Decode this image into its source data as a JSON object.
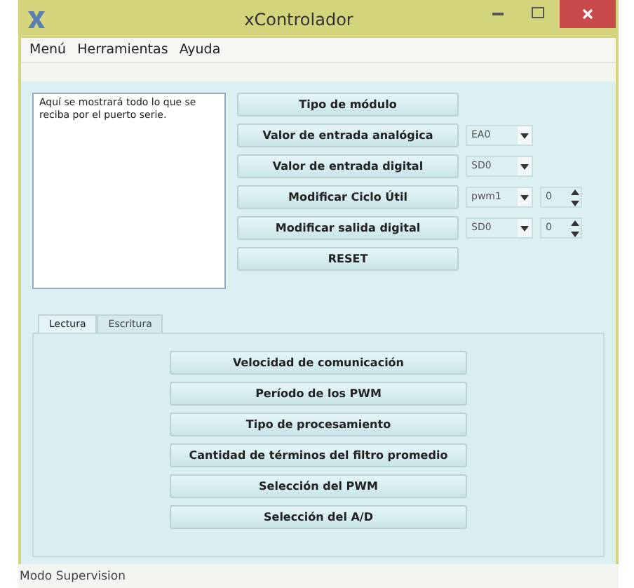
{
  "window": {
    "title": "xControlador"
  },
  "menu": [
    "Menú",
    "Herramientas",
    "Ayuda"
  ],
  "serial_output": {
    "text": "Aquí se mostrará todo lo que se reciba por el puerto serie."
  },
  "controls": [
    {
      "button": "Tipo de módulo"
    },
    {
      "button": "Valor de entrada analógica",
      "combo": "EA0"
    },
    {
      "button": "Valor de entrada digital",
      "combo": "SD0"
    },
    {
      "button": "Modificar Ciclo Útil",
      "combo": "pwm1",
      "spin": "0"
    },
    {
      "button": "Modificar salida digital",
      "combo": "SD0",
      "spin": "0"
    },
    {
      "button": "RESET"
    }
  ],
  "tabs": [
    {
      "label": "Lectura",
      "selected": true
    },
    {
      "label": "Escritura",
      "selected": false
    }
  ],
  "tab_buttons": [
    "Velocidad de comunicación",
    "Período de los PWM",
    "Tipo de procesamiento",
    "Cantidad de términos del filtro promedio",
    "Selección del PWM",
    "Selección del A/D"
  ],
  "status_bar": "Modo Supervision"
}
